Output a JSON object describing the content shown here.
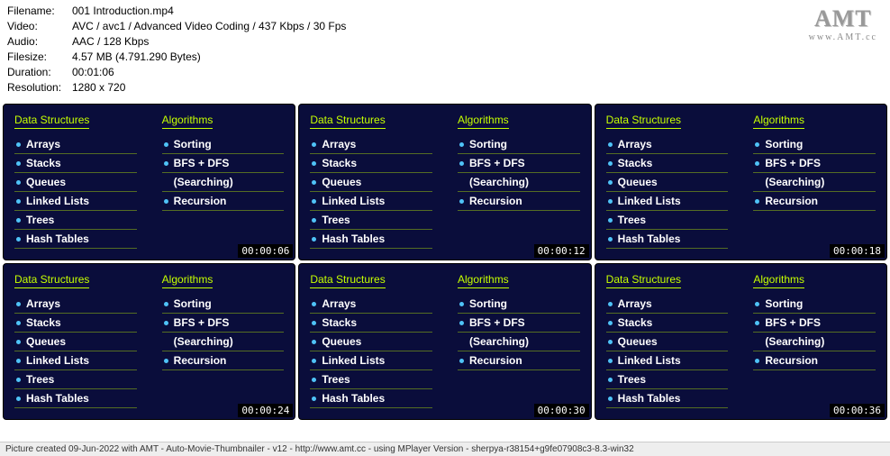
{
  "meta": {
    "filename_label": "Filename:",
    "filename": "001 Introduction.mp4",
    "video_label": "Video:",
    "video": "AVC / avc1 / Advanced Video Coding / 437 Kbps / 30 Fps",
    "audio_label": "Audio:",
    "audio": "AAC / 128 Kbps",
    "filesize_label": "Filesize:",
    "filesize": "4.57 MB (4.791.290 Bytes)",
    "duration_label": "Duration:",
    "duration": "00:01:06",
    "resolution_label": "Resolution:",
    "resolution": "1280 x 720"
  },
  "logo": {
    "main": "AMT",
    "sub": "www.AMT.cc"
  },
  "slide": {
    "col1_header": "Data Structures ",
    "col2_header": "Algorithms",
    "ds": [
      "Arrays",
      "Stacks",
      "Queues",
      "Linked Lists",
      "Trees",
      "Hash Tables"
    ],
    "algo": [
      {
        "text": "Sorting",
        "bullet": true,
        "indent": false
      },
      {
        "text": "BFS + DFS",
        "bullet": true,
        "indent": false
      },
      {
        "text": "(Searching)",
        "bullet": false,
        "indent": true
      },
      {
        "text": "Recursion",
        "bullet": true,
        "indent": false
      }
    ]
  },
  "timestamps": [
    "00:00:06",
    "00:00:12",
    "00:00:18",
    "00:00:24",
    "00:00:30",
    "00:00:36"
  ],
  "footer": "Picture created 09-Jun-2022 with AMT - Auto-Movie-Thumbnailer - v12 - http://www.amt.cc - using MPlayer Version - sherpya-r38154+g9fe07908c3-8.3-win32"
}
